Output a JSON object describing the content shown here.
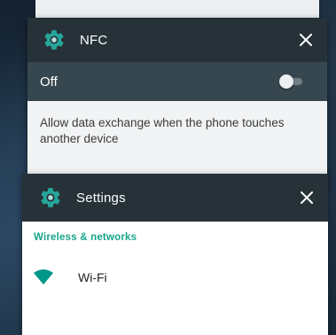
{
  "nfc_card": {
    "title": "NFC",
    "icon": "gear-icon",
    "toggle_label": "Off",
    "toggle_state": "off",
    "description": "Allow data exchange when the phone touches another device"
  },
  "settings_card": {
    "title": "Settings",
    "icon": "gear-icon",
    "section_header": "Wireless & networks",
    "items": [
      {
        "label": "Wi-Fi",
        "icon": "wifi-icon"
      }
    ]
  },
  "colors": {
    "header_bg": "#263238",
    "toggle_row_bg": "#37474f",
    "accent": "#17a589",
    "icon_teal": "#26a69a"
  }
}
